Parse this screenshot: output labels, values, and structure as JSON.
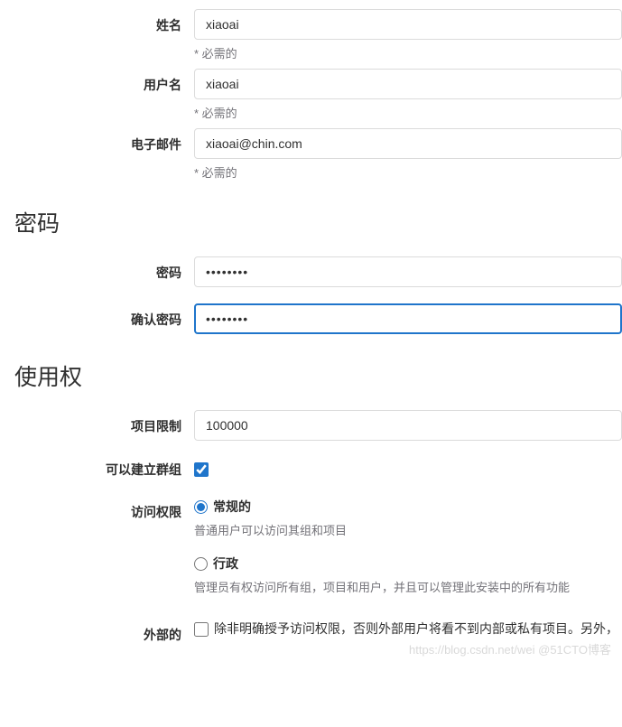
{
  "account": {
    "name_label": "姓名",
    "name_value": "xiaoai",
    "username_label": "用户名",
    "username_value": "xiaoai",
    "email_label": "电子邮件",
    "email_value": "xiaoai@chin.com",
    "required_text": "* 必需的"
  },
  "password_section": {
    "heading": "密码",
    "password_label": "密码",
    "password_value": "••••••••",
    "confirm_label": "确认密码",
    "confirm_value": "••••••••"
  },
  "access_section": {
    "heading": "使用权",
    "project_limit_label": "项目限制",
    "project_limit_value": "100000",
    "can_create_group_label": "可以建立群组",
    "access_level_label": "访问权限",
    "regular_label": "常规的",
    "regular_desc": "普通用户可以访问其组和项目",
    "admin_label": "行政",
    "admin_desc": "管理员有权访问所有组，项目和用户，并且可以管理此安装中的所有功能",
    "external_label": "外部的",
    "external_desc": "除非明确授予访问权限，否则外部用户将看不到内部或私有项目。另外，"
  },
  "watermark": "https://blog.csdn.net/wei @51CTO博客"
}
